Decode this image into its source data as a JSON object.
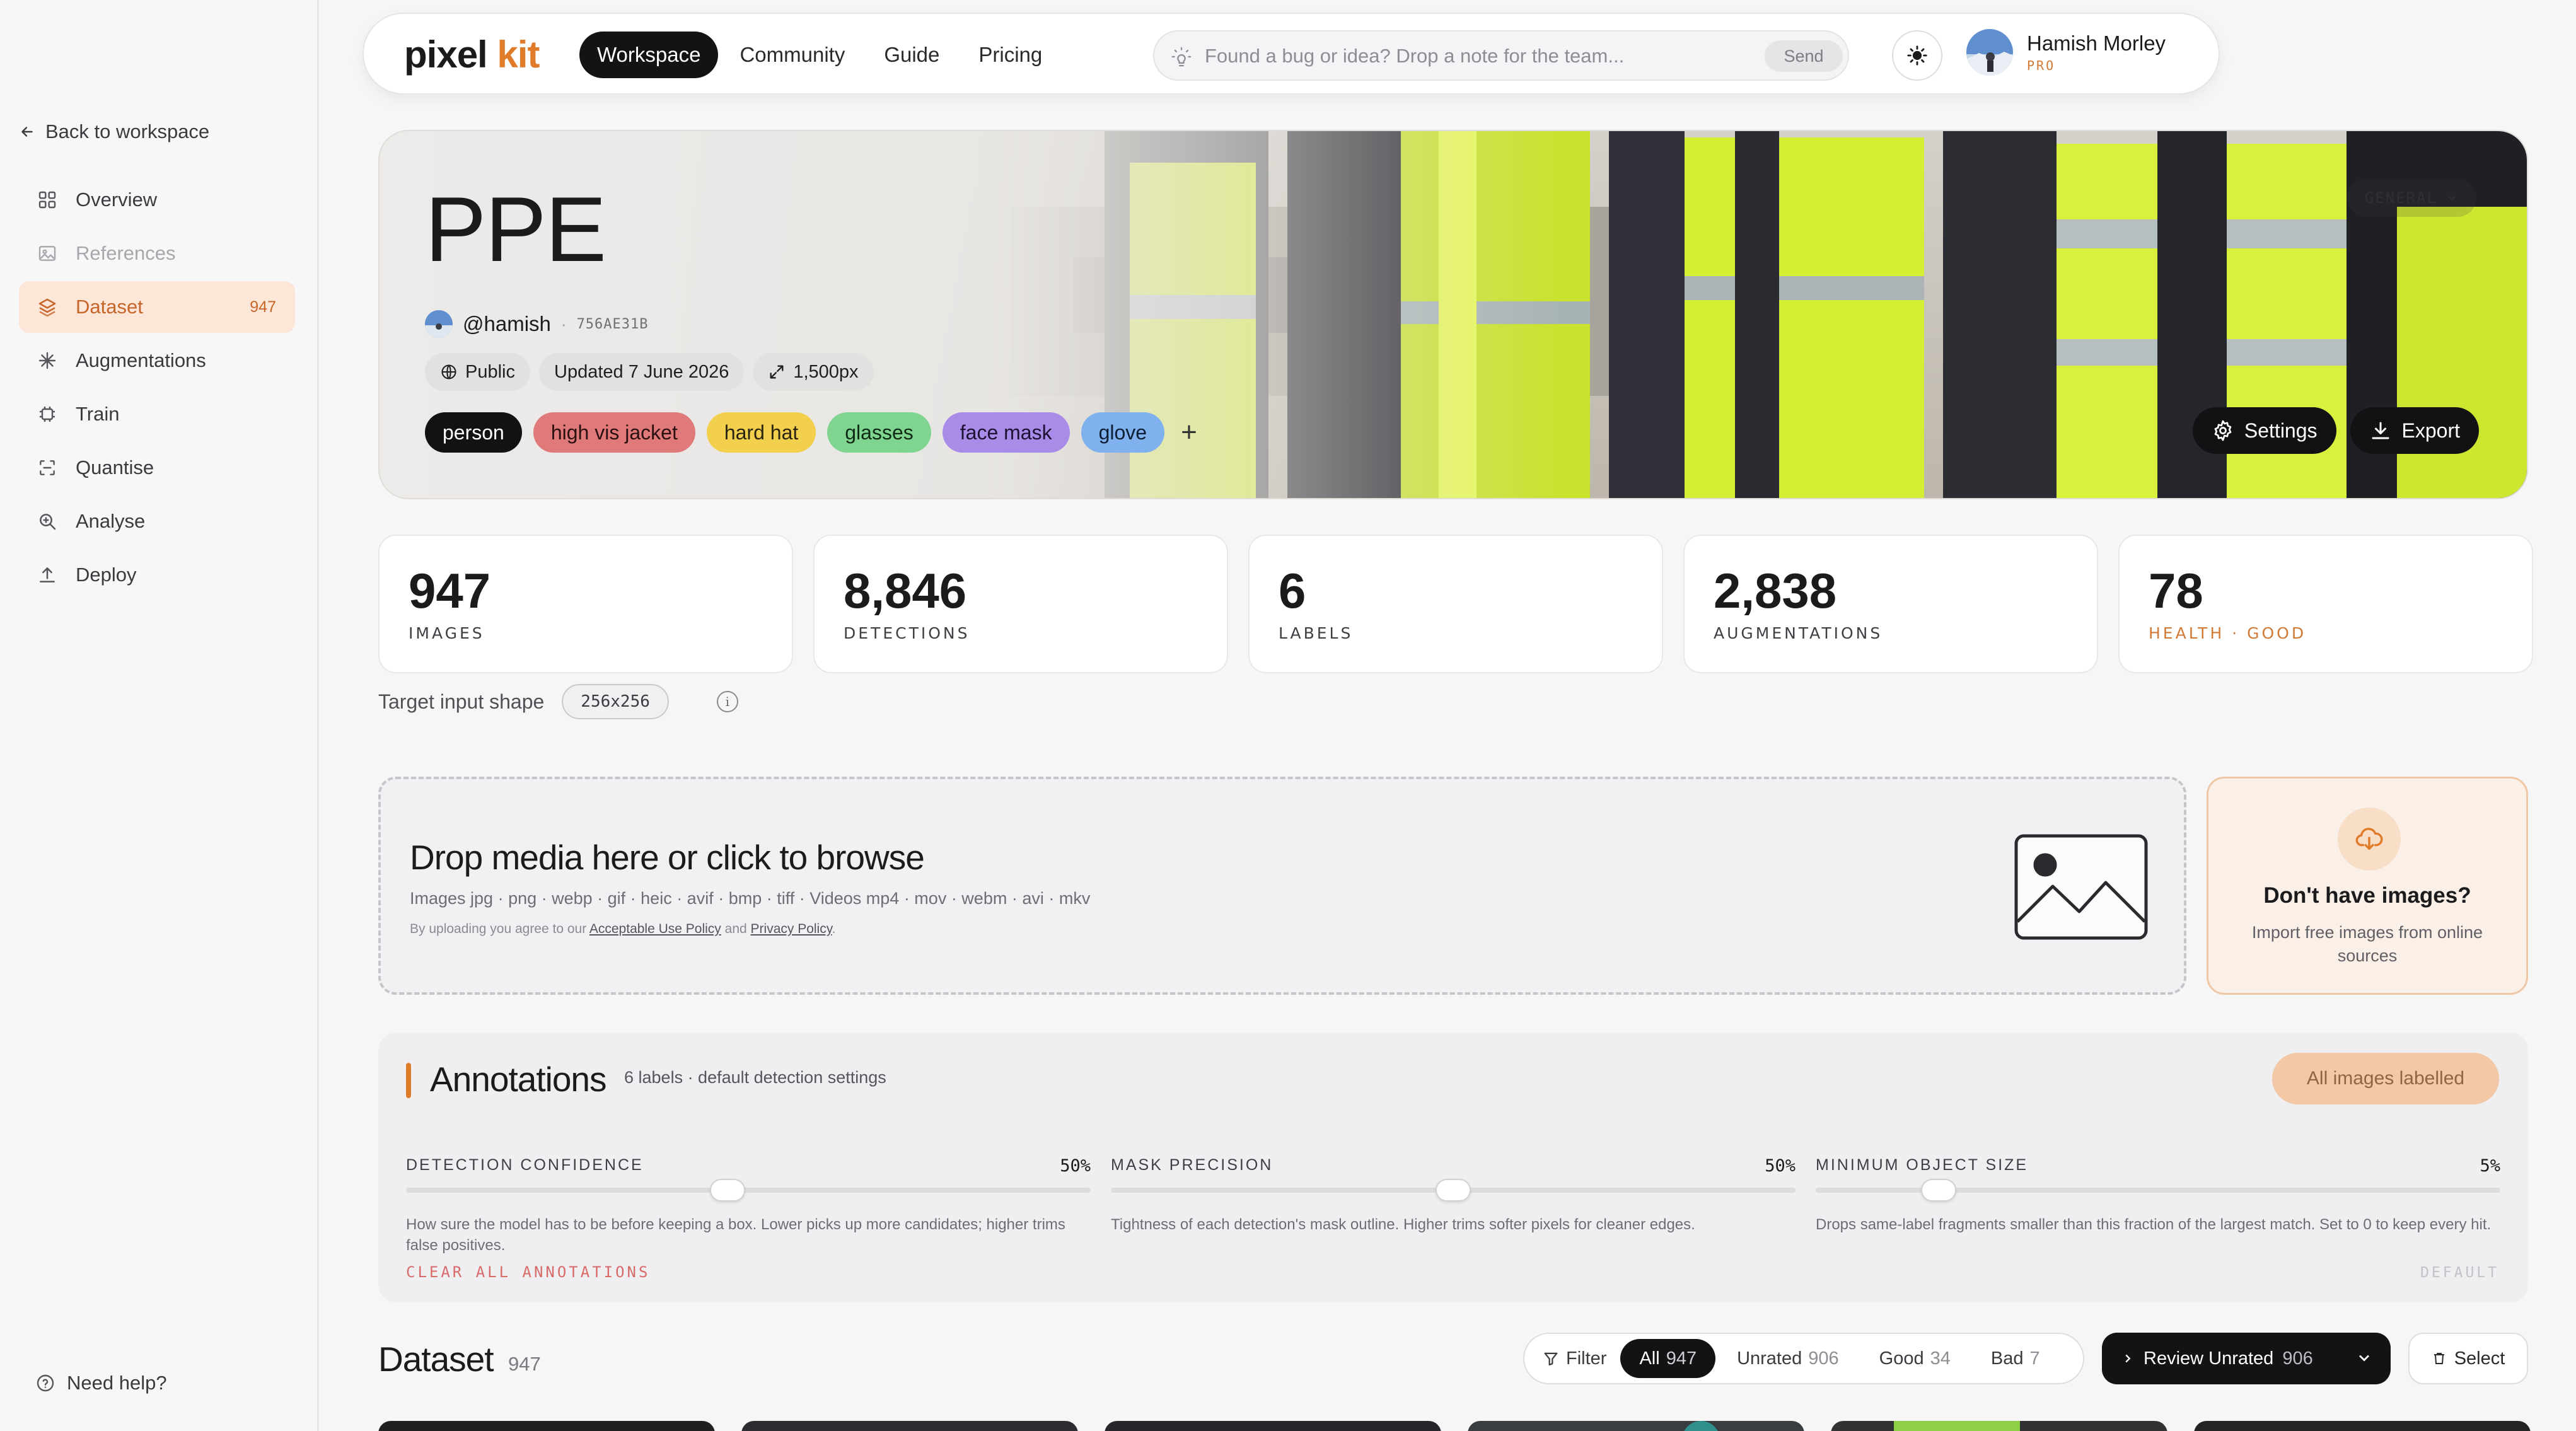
{
  "app": {
    "logo_part1": "pixel",
    "logo_part2": "kit",
    "accent": "#e07b2a"
  },
  "topnav": {
    "tabs": [
      {
        "label": "Workspace",
        "active": true
      },
      {
        "label": "Community"
      },
      {
        "label": "Guide"
      },
      {
        "label": "Pricing"
      }
    ],
    "feedback_placeholder": "Found a bug or idea? Drop a note for the team...",
    "send_label": "Send",
    "user_name": "Hamish Morley",
    "user_plan": "PRO"
  },
  "sidebar": {
    "back_label": "Back to workspace",
    "items": [
      {
        "label": "Overview",
        "icon": "grid-icon"
      },
      {
        "label": "References",
        "icon": "image-icon",
        "muted": true
      },
      {
        "label": "Dataset",
        "icon": "layers-icon",
        "active": true,
        "count": "947"
      },
      {
        "label": "Augmentations",
        "icon": "sparkle-icon"
      },
      {
        "label": "Train",
        "icon": "chip-icon"
      },
      {
        "label": "Quantise",
        "icon": "scan-icon"
      },
      {
        "label": "Analyse",
        "icon": "zoom-icon"
      },
      {
        "label": "Deploy",
        "icon": "upload-icon"
      }
    ],
    "help_label": "Need help?"
  },
  "hero": {
    "title": "PPE",
    "handle": "@hamish",
    "hash": "756AE31B",
    "visibility": "Public",
    "updated": "Updated 7 June 2026",
    "size": "1,500px",
    "general_label": "GENERAL",
    "labels": [
      {
        "text": "person",
        "bg": "#121214",
        "fg": "#ffffff"
      },
      {
        "text": "high vis jacket",
        "bg": "#e07a7a",
        "fg": "#2a1010"
      },
      {
        "text": "hard hat",
        "bg": "#f3cf4e",
        "fg": "#2a2410"
      },
      {
        "text": "glasses",
        "bg": "#7fd58f",
        "fg": "#0f2a14"
      },
      {
        "text": "face mask",
        "bg": "#a98be8",
        "fg": "#1d1233"
      },
      {
        "text": "glove",
        "bg": "#7fb1ee",
        "fg": "#0f1f33"
      }
    ],
    "settings_label": "Settings",
    "export_label": "Export"
  },
  "stats": [
    {
      "value": "947",
      "label": "IMAGES"
    },
    {
      "value": "8,846",
      "label": "DETECTIONS"
    },
    {
      "value": "6",
      "label": "LABELS"
    },
    {
      "value": "2,838",
      "label": "AUGMENTATIONS"
    },
    {
      "value": "78",
      "label": "HEALTH · GOOD",
      "good": true
    }
  ],
  "target": {
    "label": "Target input shape",
    "shape": "256x256"
  },
  "dropzone": {
    "title": "Drop media here or click to browse",
    "types": "Images jpg · png · webp · gif · heic · avif · bmp · tiff · Videos mp4 · mov · webm · avi · mkv",
    "legal_prefix": "By uploading you agree to our ",
    "aup": "Acceptable Use Policy",
    "and": " and ",
    "privacy": "Privacy Policy",
    "end": "."
  },
  "import": {
    "title": "Don't have images?",
    "subtitle": "Import free images from online sources"
  },
  "annotations": {
    "title": "Annotations",
    "subtitle": "6 labels · default detection settings",
    "status": "All images labelled",
    "sliders": [
      {
        "label": "DETECTION CONFIDENCE",
        "value": "50%",
        "level": 0.47,
        "desc": "How sure the model has to be before keeping a box. Lower picks up more candidates; higher trims false positives."
      },
      {
        "label": "MASK PRECISION",
        "value": "50%",
        "level": 0.5,
        "desc": "Tightness of each detection's mask outline. Higher trims softer pixels for cleaner edges."
      },
      {
        "label": "MINIMUM OBJECT SIZE",
        "value": "5%",
        "level": 0.18,
        "desc": "Drops same-label fragments smaller than this fraction of the largest match. Set to 0 to keep every hit."
      }
    ],
    "clear_label": "CLEAR ALL ANNOTATIONS",
    "default_label": "DEFAULT"
  },
  "dataset": {
    "title": "Dataset",
    "count": "947",
    "filter_label": "Filter",
    "filters": [
      {
        "label": "All",
        "count": "947",
        "active": true
      },
      {
        "label": "Unrated",
        "count": "906"
      },
      {
        "label": "Good",
        "count": "34"
      },
      {
        "label": "Bad",
        "count": "7"
      }
    ],
    "review_label": "Review Unrated",
    "review_count": "906",
    "select_label": "Select"
  }
}
